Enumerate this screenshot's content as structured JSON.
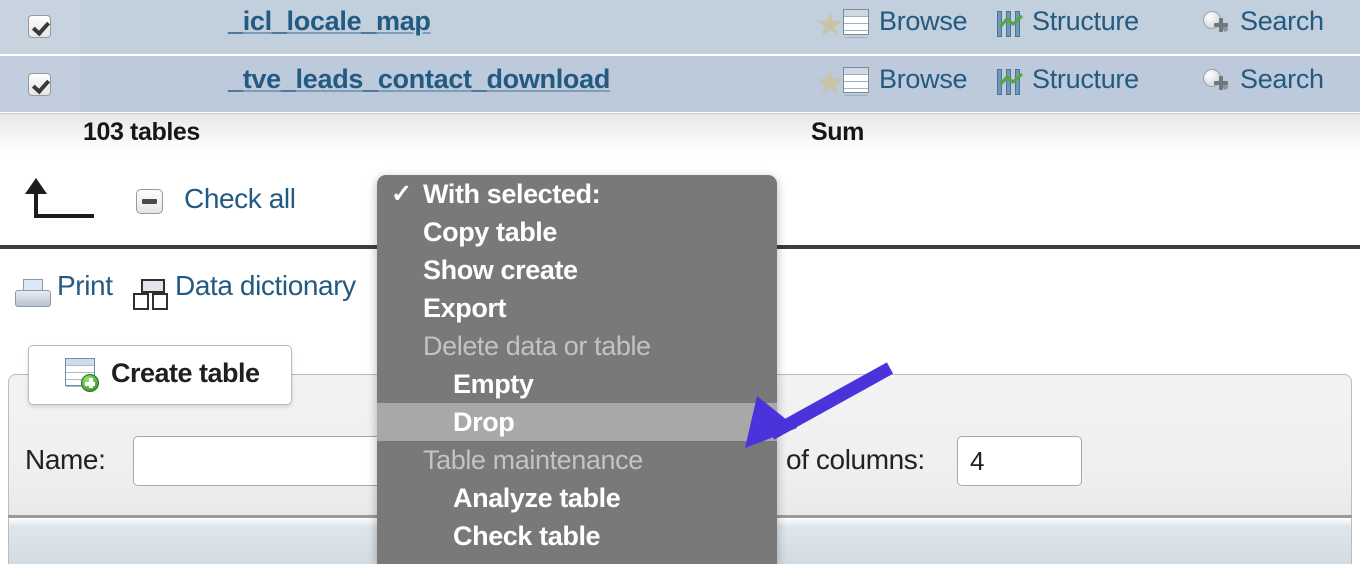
{
  "table_list": {
    "rows": [
      {
        "checked": true,
        "name": "_icl_locale_map",
        "favorite_icon": "star-icon",
        "browse_label": "Browse",
        "structure_label": "Structure",
        "search_label": "Search"
      },
      {
        "checked": true,
        "name": "_tve_leads_contact_download",
        "favorite_icon": "star-icon",
        "browse_label": "Browse",
        "structure_label": "Structure",
        "search_label": "Search"
      }
    ],
    "footer": {
      "count_label": "103 tables",
      "sum_label": "Sum"
    }
  },
  "toolbar": {
    "with_selected_arrow_icon": "arrow-up-left-icon",
    "check_all_label": "Check all",
    "check_all_state": "indeterminate"
  },
  "doc_links": {
    "print_label": "Print",
    "print_icon": "printer-icon",
    "data_dictionary_label": "Data dictionary",
    "data_dictionary_icon": "data-dictionary-icon"
  },
  "create_table": {
    "tab_label": "Create table",
    "tab_icon": "table-add-icon",
    "name_label": "Name:",
    "name_value": "",
    "name_placeholder": "",
    "columns_label": "of columns:",
    "columns_value": "4"
  },
  "dropdown": {
    "items": [
      {
        "label": "With selected:",
        "type": "checked-header",
        "indent": false,
        "selected": false
      },
      {
        "label": "Copy table",
        "type": "option",
        "indent": false,
        "selected": false
      },
      {
        "label": "Show create",
        "type": "option",
        "indent": false,
        "selected": false
      },
      {
        "label": "Export",
        "type": "option",
        "indent": false,
        "selected": false
      },
      {
        "label": "Delete data or table",
        "type": "group-header",
        "indent": false,
        "selected": false
      },
      {
        "label": "Empty",
        "type": "option",
        "indent": true,
        "selected": false
      },
      {
        "label": "Drop",
        "type": "option",
        "indent": true,
        "selected": true
      },
      {
        "label": "Table maintenance",
        "type": "group-header",
        "indent": false,
        "selected": false
      },
      {
        "label": "Analyze table",
        "type": "option",
        "indent": true,
        "selected": false
      },
      {
        "label": "Check table",
        "type": "option",
        "indent": true,
        "selected": false
      }
    ],
    "check_glyph": "✓",
    "background_color": "#797979",
    "selected_color": "#a8a8a8"
  },
  "annotation": {
    "arrow_color": "#4b33dc",
    "points_to": "Drop"
  },
  "colors": {
    "row_background": "#bfccdc",
    "link_text": "#235a81",
    "menu_background": "#797979",
    "accent_purple": "#4b33dc"
  }
}
